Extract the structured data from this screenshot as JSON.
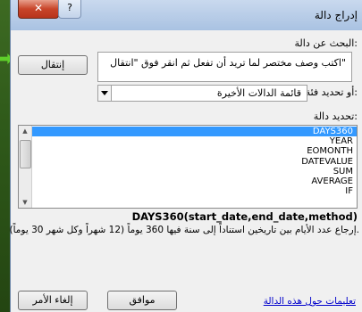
{
  "window": {
    "title": "إدراج دالة",
    "close_glyph": "✕",
    "help_glyph": "?"
  },
  "search": {
    "label": "البحث عن دالة:",
    "value": "اكتب وصف مختصر لما تريد أن تفعل ثم انقر فوق \"انتقال\"",
    "go_label": "إنتقال"
  },
  "category": {
    "label": "أو تحديد فئة:",
    "value": "قائمة الدالات الأخيرة"
  },
  "functions": {
    "label": "تحديد دالة:",
    "items": [
      "DAYS360",
      "YEAR",
      "EOMONTH",
      "DATEVALUE",
      "SUM",
      "AVERAGE",
      "IF"
    ],
    "selected": "DAYS360"
  },
  "signature": "DAYS360(start_date,end_date,method)",
  "description": "إرجاع عدد الأيام بين تاريخين استناداً إلى سنة فيها 360 يوماً (12 شهراً وكل شهر 30 يوماً).",
  "footer": {
    "help_link": "تعليمات حول هذه الدالة",
    "ok_label": "موافق",
    "cancel_label": "إلغاء الأمر"
  }
}
